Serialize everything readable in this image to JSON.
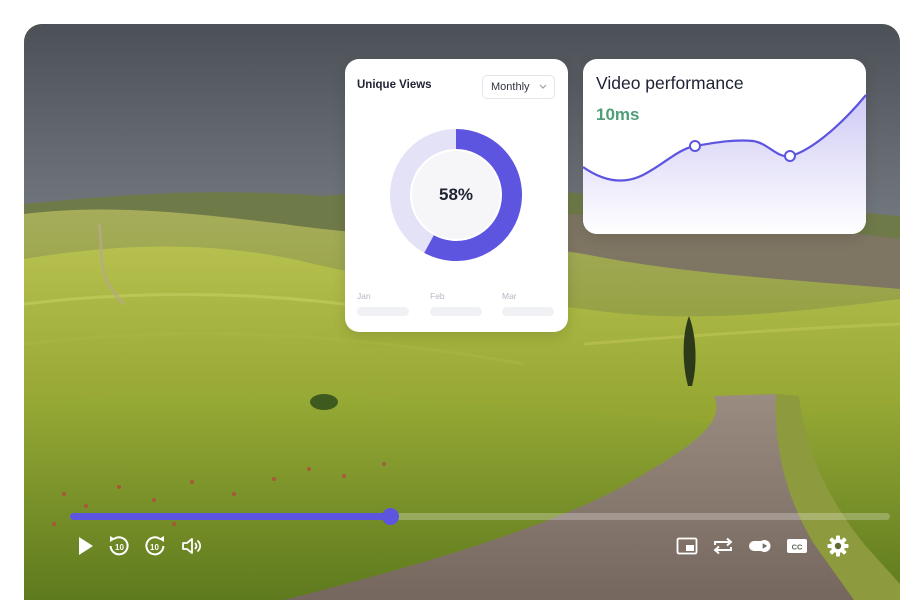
{
  "views_card": {
    "title": "Unique Views",
    "period_select": "Monthly",
    "percent": 58,
    "percent_label": "58%",
    "months": [
      "Jan",
      "Feb",
      "Mar"
    ],
    "colors": {
      "fill": "#5d55e0",
      "track": "#e4e2f7"
    }
  },
  "performance_card": {
    "title": "Video performance",
    "metric": "10ms",
    "metric_color": "#4f9e78",
    "line_color": "#5d55e0"
  },
  "player": {
    "progress": 0.39,
    "controls": {
      "left": [
        {
          "name": "play-button",
          "icon": "play-icon"
        },
        {
          "name": "rewind-10-button",
          "icon": "rewind-10-icon"
        },
        {
          "name": "forward-10-button",
          "icon": "forward-10-icon"
        },
        {
          "name": "volume-button",
          "icon": "volume-icon"
        }
      ],
      "right": [
        {
          "name": "picture-in-picture-button",
          "icon": "picture-in-picture-icon"
        },
        {
          "name": "loop-button",
          "icon": "loop-icon"
        },
        {
          "name": "autoplay-toggle",
          "icon": "autoplay-icon"
        },
        {
          "name": "captions-button",
          "icon": "closed-captions-icon",
          "label": "CC"
        },
        {
          "name": "settings-button",
          "icon": "gear-icon"
        }
      ]
    },
    "accent": "#5d55e0"
  }
}
